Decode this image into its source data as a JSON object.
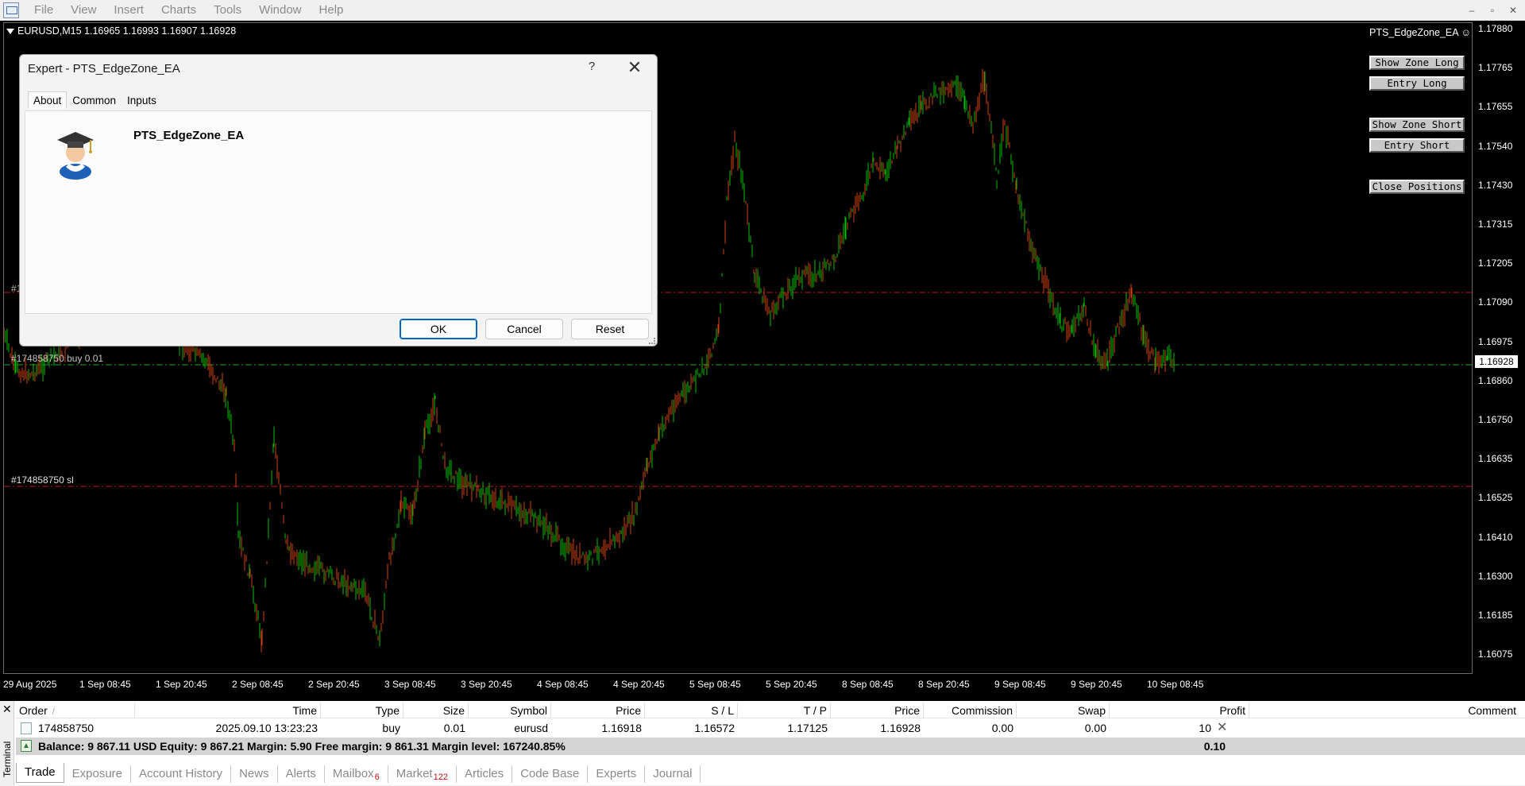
{
  "menu": [
    "File",
    "View",
    "Insert",
    "Charts",
    "Tools",
    "Window",
    "Help"
  ],
  "window_controls": [
    "–",
    "▫",
    "✕"
  ],
  "chart": {
    "symbol_info": "EURUSD,M15  1.16965 1.16993 1.16907 1.16928",
    "ea_label": "PTS_EdgeZone_EA ☺",
    "ea_buttons": [
      "Show Zone Long",
      "Entry Long",
      "Show Zone Short",
      "Entry Short",
      "Close Positions"
    ],
    "price_labels": [
      "1.17880",
      "1.17765",
      "1.17655",
      "1.17540",
      "1.17430",
      "1.17315",
      "1.17205",
      "1.17090",
      "1.16975",
      "1.16860",
      "1.16750",
      "1.16635",
      "1.16525",
      "1.16410",
      "1.16300",
      "1.16185",
      "1.16075"
    ],
    "current_price": "1.16928",
    "time_labels": [
      "29 Aug 2025",
      "1 Sep 08:45",
      "1 Sep 20:45",
      "2 Sep 08:45",
      "2 Sep 20:45",
      "3 Sep 08:45",
      "3 Sep 20:45",
      "4 Sep 08:45",
      "4 Sep 20:45",
      "5 Sep 08:45",
      "5 Sep 20:45",
      "8 Sep 08:45",
      "8 Sep 20:45",
      "9 Sep 08:45",
      "9 Sep 20:45",
      "10 Sep 08:45"
    ],
    "order_labels": {
      "tp": "#1",
      "buy": "#174858750 buy 0.01",
      "sl": "#174858750 sl"
    },
    "colors": {
      "bull": "#00c000",
      "bear": "#d04010",
      "tp_line": "#c01818",
      "buy_line": "#20a030",
      "sl_line": "#c01818"
    }
  },
  "dialog": {
    "title": "Expert - PTS_EdgeZone_EA",
    "help": "?",
    "close": "✕",
    "tabs": [
      "About",
      "Common",
      "Inputs"
    ],
    "active_tab": "About",
    "expert_name": "PTS_EdgeZone_EA",
    "buttons": {
      "ok": "OK",
      "cancel": "Cancel",
      "reset": "Reset"
    }
  },
  "terminal": {
    "close": "✕",
    "side_label": "Terminal",
    "headers": [
      "Order",
      "/",
      "Time",
      "Type",
      "Size",
      "Symbol",
      "Price",
      "S / L",
      "T / P",
      "Price",
      "Commission",
      "Swap",
      "Profit",
      "Comment"
    ],
    "position": {
      "order": "174858750",
      "time": "2025.09.10 13:23:23",
      "type": "buy",
      "size": "0.01",
      "symbol": "eurusd",
      "price": "1.16918",
      "sl": "1.16572",
      "tp": "1.17125",
      "cur_price": "1.16928",
      "commission": "0.00",
      "swap": "0.00",
      "profit": "10",
      "comment": ""
    },
    "balance_text": "Balance: 9 867.11 USD  Equity: 9 867.21  Margin: 5.90  Free margin: 9 861.31  Margin level: 167240.85%",
    "total_profit": "0.10",
    "tabs": [
      {
        "label": "Trade",
        "badge": ""
      },
      {
        "label": "Exposure",
        "badge": ""
      },
      {
        "label": "Account History",
        "badge": ""
      },
      {
        "label": "News",
        "badge": ""
      },
      {
        "label": "Alerts",
        "badge": ""
      },
      {
        "label": "Mailbox",
        "badge": "6"
      },
      {
        "label": "Market",
        "badge": "122"
      },
      {
        "label": "Articles",
        "badge": ""
      },
      {
        "label": "Code Base",
        "badge": ""
      },
      {
        "label": "Experts",
        "badge": ""
      },
      {
        "label": "Journal",
        "badge": ""
      }
    ],
    "active_tab": "Trade"
  }
}
